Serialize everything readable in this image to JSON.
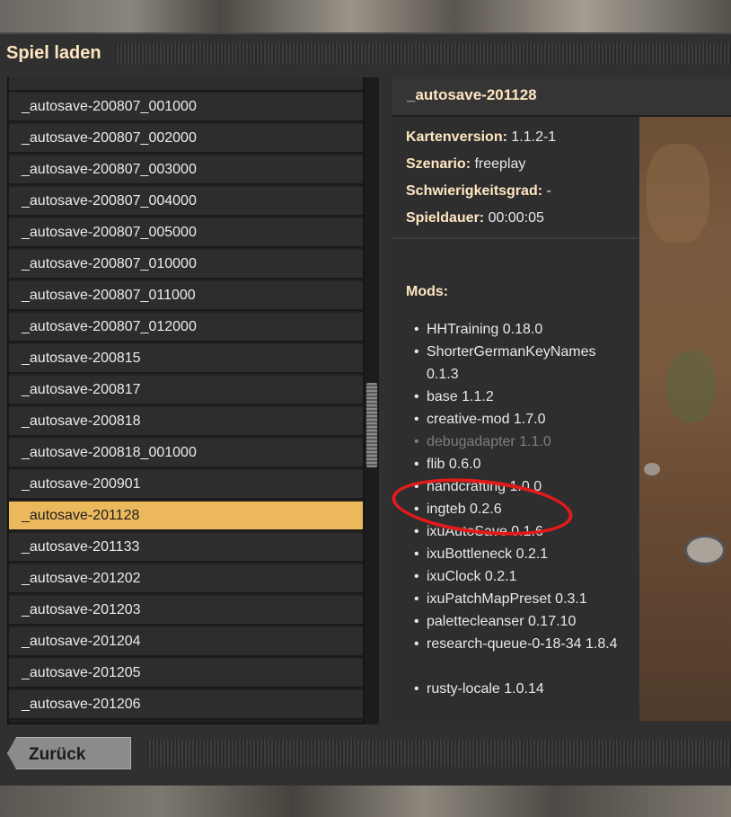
{
  "window": {
    "title": "Spiel laden"
  },
  "saves": [
    "_autosave-200807_001000",
    "_autosave-200807_002000",
    "_autosave-200807_003000",
    "_autosave-200807_004000",
    "_autosave-200807_005000",
    "_autosave-200807_010000",
    "_autosave-200807_011000",
    "_autosave-200807_012000",
    "_autosave-200815",
    "_autosave-200817",
    "_autosave-200818",
    "_autosave-200818_001000",
    "_autosave-200901",
    "_autosave-201128",
    "_autosave-201133",
    "_autosave-201202",
    "_autosave-201203",
    "_autosave-201204",
    "_autosave-201205",
    "_autosave-201206"
  ],
  "selected_save": "_autosave-201128",
  "details": {
    "title": "_autosave-201128",
    "map_version_label": "Kartenversion:",
    "map_version": "1.1.2-1",
    "scenario_label": "Szenario:",
    "scenario": "freeplay",
    "difficulty_label": "Schwierigkeitsgrad:",
    "difficulty": "-",
    "playtime_label": "Spieldauer:",
    "playtime": "00:00:05",
    "mods_label": "Mods:",
    "mods": [
      "HHTraining 0.18.0",
      "ShorterGermanKeyNames 0.1.3",
      "base 1.1.2",
      "creative-mod 1.7.0",
      "debugadapter 1.1.0",
      "flib 0.6.0",
      "handcrafting 1.0.0",
      "ingteb 0.2.6",
      "ixuAutoSave 0.1.6",
      "ixuBottleneck 0.2.1",
      "ixuClock 0.2.1",
      "ixuPatchMapPreset 0.3.1",
      "palettecleanser 0.17.10",
      "research-queue-0-18-34 1.8.4",
      "rusty-locale 1.0.14"
    ],
    "bullet": "•"
  },
  "footer": {
    "back_label": "Zurück"
  },
  "colors": {
    "accent": "#ebb95b",
    "heading": "#ffe6c0",
    "annotation": "#e21a1a"
  }
}
